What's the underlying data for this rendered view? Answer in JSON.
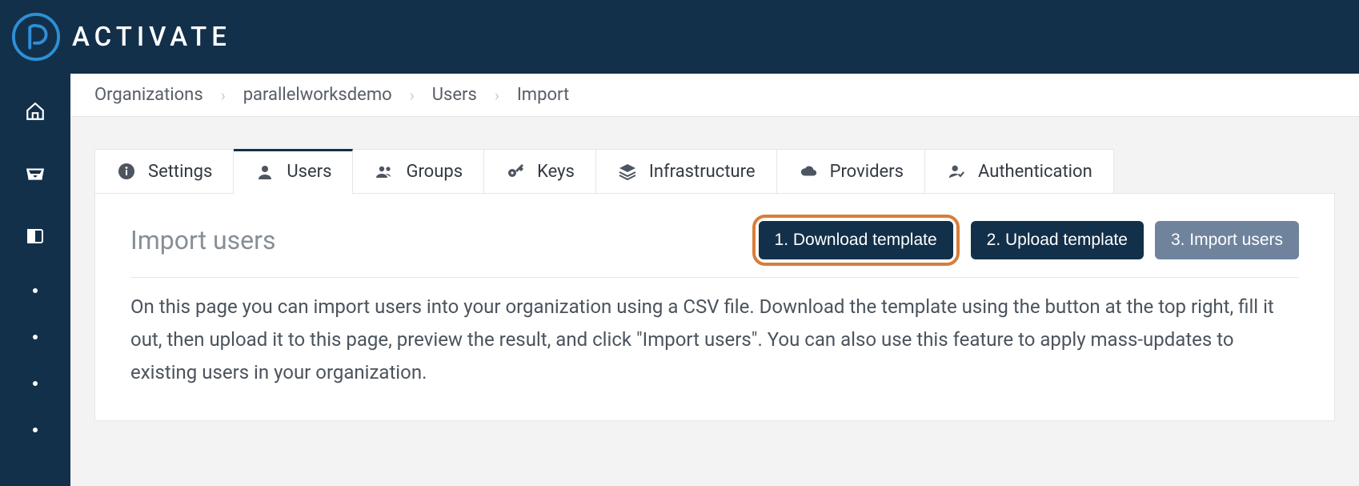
{
  "brand": {
    "name": "ACTIVATE"
  },
  "breadcrumbs": [
    "Organizations",
    "parallelworksdemo",
    "Users",
    "Import"
  ],
  "tabs": [
    {
      "label": "Settings",
      "icon": "info"
    },
    {
      "label": "Users",
      "icon": "user",
      "active": true
    },
    {
      "label": "Groups",
      "icon": "group"
    },
    {
      "label": "Keys",
      "icon": "key"
    },
    {
      "label": "Infrastructure",
      "icon": "layers"
    },
    {
      "label": "Providers",
      "icon": "cloud"
    },
    {
      "label": "Authentication",
      "icon": "user-check"
    }
  ],
  "page": {
    "heading": "Import users",
    "steps": {
      "s1": "1. Download template",
      "s2": "2. Upload template",
      "s3": "3. Import users"
    },
    "description": "On this page you can import users into your organization using a CSV file. Download the template using the button at the top right, fill it out, then upload it to this page, preview the result, and click \"Import users\". You can also use this feature to apply mass-updates to existing users in your organization."
  }
}
